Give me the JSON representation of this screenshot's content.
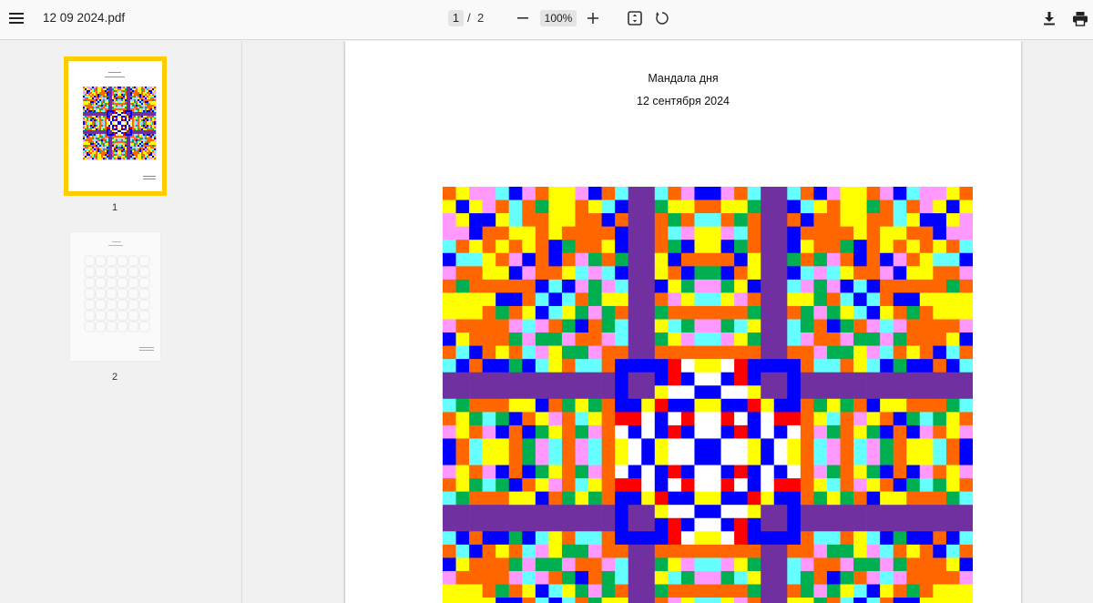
{
  "toolbar": {
    "file_name": "12 09 2024.pdf",
    "current_page": "1",
    "page_separator": "/",
    "total_pages": "2",
    "zoom": "100%"
  },
  "sidebar": {
    "thumbnails": [
      {
        "label": "1",
        "selected": true
      },
      {
        "label": "2",
        "selected": false
      }
    ]
  },
  "document": {
    "title": "Мандала дня",
    "date": "12 сентября 2024"
  },
  "colors": {
    "selection": "#ffcc00",
    "mandala_band": "#7030a0",
    "palette": [
      "#ff0000",
      "#0000ff",
      "#ffff00",
      "#00b050",
      "#66ffff",
      "#ff99ff",
      "#ff6600",
      "#7030a0",
      "#ffffff",
      "#ff66ff",
      "#3399ff",
      "#00cc66"
    ]
  },
  "icons": [
    "menu-icon",
    "minus-icon",
    "plus-icon",
    "fit-page-icon",
    "rotate-icon",
    "download-icon",
    "print-icon"
  ]
}
